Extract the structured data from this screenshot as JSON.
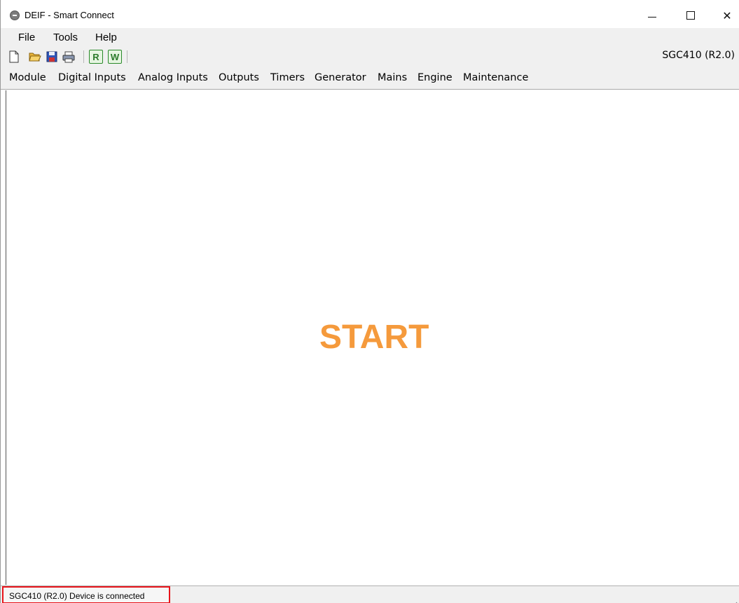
{
  "window": {
    "title": "DEIF - Smart Connect",
    "controls": {
      "minimize": "minimize-icon",
      "maximize": "maximize-icon",
      "close": "close-icon",
      "close_glyph": "✕"
    }
  },
  "menubar": {
    "items": [
      {
        "label": "File"
      },
      {
        "label": "Tools"
      },
      {
        "label": "Help"
      }
    ]
  },
  "toolbar": {
    "buttons": [
      "new-file-icon",
      "open-folder-icon",
      "save-icon",
      "print-icon"
    ],
    "read_label": "R",
    "write_label": "W",
    "device": "SGC410 (R2.0)"
  },
  "nav": {
    "tabs": [
      {
        "label": "Module"
      },
      {
        "label": "Digital Inputs"
      },
      {
        "label": "Analog Inputs"
      },
      {
        "label": "Outputs"
      },
      {
        "label": "Timers"
      },
      {
        "label": "Generator"
      },
      {
        "label": "Mains"
      },
      {
        "label": "Engine"
      },
      {
        "label": "Maintenance"
      }
    ]
  },
  "main": {
    "start_label": "START",
    "start_color": "#f59a3c"
  },
  "status": {
    "text": "SGC410 (R2.0) Device is connected",
    "highlight_color": "#e8141b"
  }
}
